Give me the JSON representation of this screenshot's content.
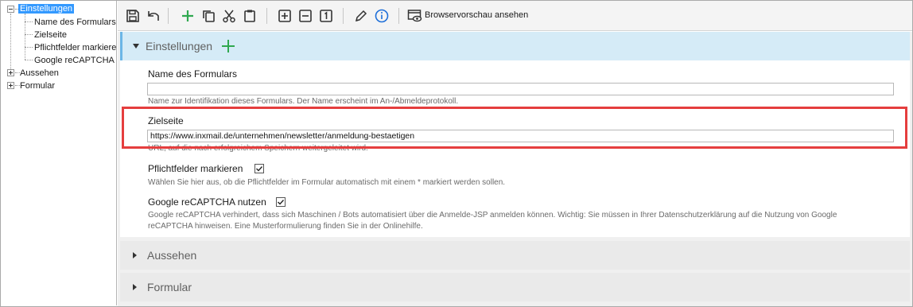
{
  "tree": {
    "root": "Einstellungen",
    "children": [
      "Name des Formulars",
      "Zielseite",
      "Pflichtfelder markiere",
      "Google reCAPTCHA n"
    ],
    "collapsed": [
      "Aussehen",
      "Formular"
    ]
  },
  "toolbar": {
    "icons": [
      "save-icon",
      "undo-icon",
      "add-icon",
      "copy-icon",
      "cut-icon",
      "paste-icon",
      "expand-icon",
      "collapse-icon",
      "level-one-icon",
      "edit-icon",
      "info-icon",
      "preview-icon"
    ],
    "preview_label": "Browservorschau ansehen"
  },
  "sections": {
    "settings": {
      "title": "Einstellungen",
      "name_label": "Name des Formulars",
      "name_value": "",
      "name_help": "Name zur Identifikation dieses Formulars. Der Name erscheint im An-/Abmeldeprotokoll.",
      "target_label": "Zielseite",
      "target_value": "https://www.inxmail.de/unternehmen/newsletter/anmeldung-bestaetigen",
      "target_help": "URL, auf die nach erfolgreichem Speichern weitergeleitet wird.",
      "required_label": "Pflichtfelder markieren",
      "required_checked": true,
      "required_help": "Wählen Sie hier aus, ob die Pflichtfelder im Formular automatisch mit einem * markiert werden sollen.",
      "captcha_label": "Google reCAPTCHA nutzen",
      "captcha_checked": true,
      "captcha_help_1": "Google reCAPTCHA verhindert, dass sich Maschinen / Bots automatisiert über die Anmelde-JSP anmelden können. Wichtig: Sie müssen in Ihrer Datenschutzerklärung auf die Nutzung von Google",
      "captcha_help_2": "reCAPTCHA hinweisen. Eine Musterformulierung finden Sie in der Onlinehilfe."
    },
    "appearance": {
      "title": "Aussehen"
    },
    "form": {
      "title": "Formular"
    }
  },
  "colors": {
    "accent": "#3399ff",
    "section_header": "#d5ebf7",
    "highlight": "#e53e3e",
    "add_green": "#2fa84f",
    "info_blue": "#1e6fd9"
  }
}
